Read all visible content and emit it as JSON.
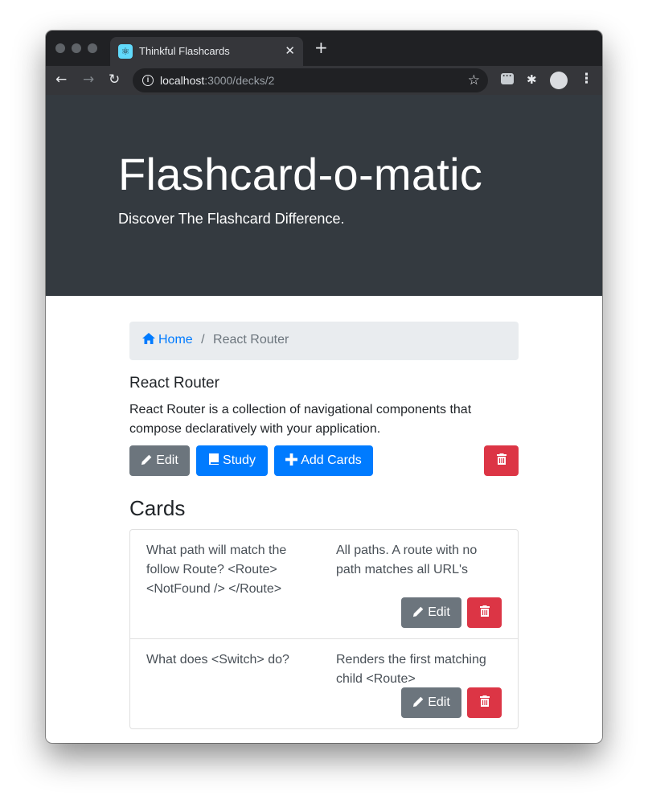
{
  "browser": {
    "tab_title": "Thinkful Flashcards",
    "tab_close": "✕",
    "new_tab": "+",
    "url_host": "localhost",
    "url_rest": ":3000/decks/2",
    "icons": [
      "react-favicon-icon",
      "back-arrow-icon",
      "forward-arrow-icon",
      "reload-icon",
      "info-icon",
      "star-icon",
      "extension-icon",
      "puzzle-icon",
      "profile-avatar",
      "menu-icon"
    ]
  },
  "header": {
    "title": "Flashcard-o-matic",
    "subtitle": "Discover The Flashcard Difference."
  },
  "breadcrumb": {
    "home": "Home",
    "separator": "/",
    "current": "React Router"
  },
  "deck": {
    "name": "React Router",
    "description": "React Router is a collection of navigational components that compose declaratively with your application.",
    "buttons": {
      "edit": "Edit",
      "study": "Study",
      "add_cards": "Add Cards"
    }
  },
  "cards_heading": "Cards",
  "cards": [
    {
      "front": "What path will match the follow Route? <Route> <NotFound /> </Route>",
      "back": "All paths. A route with no path matches all URL's",
      "edit_label": "Edit"
    },
    {
      "front": "What does <Switch> do?",
      "back": "Renders the first matching child <Route>",
      "edit_label": "Edit"
    }
  ],
  "colors": {
    "jumbotron": "#343a40",
    "primary": "#007bff",
    "secondary": "#6c757d",
    "danger": "#dc3545",
    "breadcrumb_bg": "#e9ecef"
  }
}
